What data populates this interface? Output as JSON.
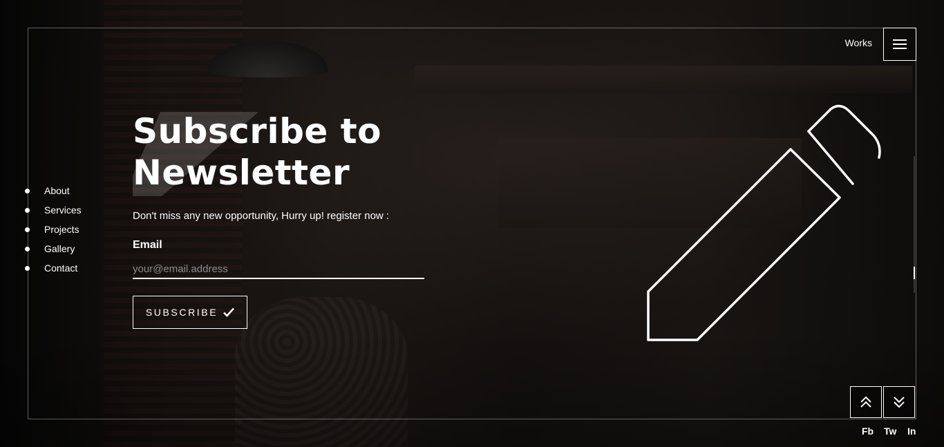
{
  "header": {
    "works_label": "Works",
    "menu_icon": "hamburger-icon"
  },
  "side_nav": {
    "items": [
      {
        "label": "About"
      },
      {
        "label": "Services"
      },
      {
        "label": "Projects"
      },
      {
        "label": "Gallery"
      },
      {
        "label": "Contact"
      }
    ]
  },
  "newsletter": {
    "title_line1": "Subscribe to",
    "title_line2": "Newsletter",
    "subtitle": "Don't miss any new opportunity, Hurry up! register now :",
    "email_label": "Email",
    "email_placeholder": "your@email.address",
    "email_value": "",
    "button_label": "SUBSCRIBE",
    "button_icon": "check-icon"
  },
  "illustration": {
    "icon": "pen-icon"
  },
  "section_nav": {
    "up_icon": "double-chevron-up-icon",
    "down_icon": "double-chevron-down-icon"
  },
  "social": {
    "fb": "Fb",
    "tw": "Tw",
    "in": "In"
  },
  "colors": {
    "background": "#0b0b0b",
    "foreground": "#ffffff",
    "placeholder": "#8a8a8a"
  }
}
